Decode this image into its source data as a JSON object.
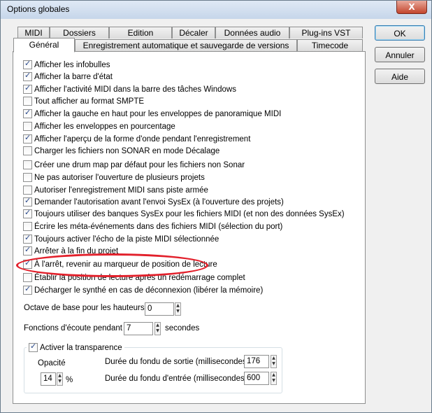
{
  "window": {
    "title": "Options globales",
    "close_label": "X"
  },
  "tabs_row1": [
    "MIDI",
    "Dossiers",
    "Edition",
    "Décaler",
    "Données audio",
    "Plug-ins VST"
  ],
  "tabs_row2": [
    "Général",
    "Enregistrement automatique et sauvegarde de versions",
    "Timecode"
  ],
  "buttons": {
    "ok": "OK",
    "cancel": "Annuler",
    "help": "Aide"
  },
  "options": [
    {
      "label": "Afficher les infobulles",
      "checked": true
    },
    {
      "label": "Afficher la barre d'état",
      "checked": true
    },
    {
      "label": "Afficher l'activité MIDI dans la barre des tâches Windows",
      "checked": true
    },
    {
      "label": "Tout afficher au format SMPTE",
      "checked": false
    },
    {
      "label": "Afficher la gauche en haut pour les enveloppes de panoramique MIDI",
      "checked": true
    },
    {
      "label": "Afficher les enveloppes en pourcentage",
      "checked": false
    },
    {
      "label": "Afficher l'aperçu de la forme d'onde pendant l'enregistrement",
      "checked": true
    },
    {
      "label": "Charger les fichiers non SONAR en mode Décalage",
      "checked": false
    },
    {
      "label": "Créer une drum map par défaut pour les fichiers non Sonar",
      "checked": false
    },
    {
      "label": "Ne pas autoriser l'ouverture de plusieurs projets",
      "checked": false
    },
    {
      "label": "Autoriser l'enregistrement MIDI sans piste armée",
      "checked": false
    },
    {
      "label": "Demander l'autorisation avant l'envoi SysEx (à l'ouverture des projets)",
      "checked": true
    },
    {
      "label": "Toujours utiliser des banques SysEx pour les fichiers MIDI (et non des données SysEx)",
      "checked": true
    },
    {
      "label": "Écrire les méta-événements dans des fichiers MIDI (sélection du port)",
      "checked": false
    },
    {
      "label": "Toujours activer l'écho de la piste MIDI sélectionnée",
      "checked": true
    },
    {
      "label": "Arrêter à la fin du projet",
      "checked": true
    },
    {
      "label": "À l'arrêt, revenir au marqueur de position de lecture",
      "checked": true
    },
    {
      "label": "Établir la position de lecture après un redémarrage complet",
      "checked": false
    },
    {
      "label": "Décharger le synthé en cas de déconnexion (libérer la mémoire)",
      "checked": true
    }
  ],
  "octave": {
    "label": "Octave de base pour les hauteurs",
    "value": "0"
  },
  "listen": {
    "label": "Fonctions d'écoute pendant",
    "value": "7",
    "unit": "secondes"
  },
  "transparency": {
    "label": "Activer la transparence",
    "checked": true,
    "opacity_label": "Opacité",
    "opacity_value": "14",
    "opacity_unit": "%",
    "fade_out_label": "Durée du fondu de sortie (millisecondes) :",
    "fade_out_value": "176",
    "fade_in_label": "Durée du fondu d'entrée (millisecondes) :",
    "fade_in_value": "600"
  },
  "annotation_color": "#e2202b"
}
